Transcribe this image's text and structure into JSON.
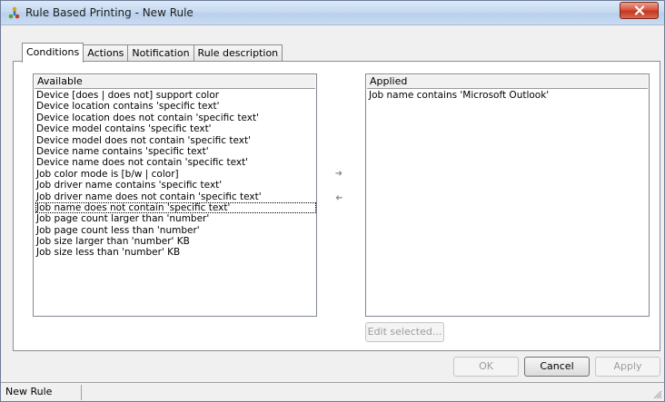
{
  "window": {
    "title": "Rule Based Printing - New Rule"
  },
  "tabs": [
    {
      "label": "Conditions"
    },
    {
      "label": "Actions"
    },
    {
      "label": "Notification"
    },
    {
      "label": "Rule description"
    }
  ],
  "available": {
    "header": "Available",
    "items": [
      "Device [does | does not] support color",
      "Device location contains 'specific text'",
      "Device location does not contain 'specific text'",
      "Device model contains 'specific text'",
      "Device model does not contain 'specific text'",
      "Device name contains 'specific text'",
      "Device name does not contain 'specific text'",
      "Job color mode is [b/w | color]",
      "Job driver name contains 'specific text'",
      "Job driver name does not contain 'specific text'",
      "Job name does not contain 'specific text'",
      "Job page count larger than 'number'",
      "Job page count less than 'number'",
      "Job size larger than 'number' KB",
      "Job size less than 'number' KB"
    ]
  },
  "applied": {
    "header": "Applied",
    "items": [
      "Job name contains 'Microsoft Outlook'"
    ]
  },
  "buttons": {
    "edit_selected": "Edit selected...",
    "ok": "OK",
    "cancel": "Cancel",
    "apply": "Apply"
  },
  "status": {
    "text": "New Rule"
  },
  "icons": {
    "app": "printer-rule-icon",
    "close": "close-icon",
    "add": "arrow-right-icon",
    "remove": "arrow-left-icon",
    "grip": "resize-grip-icon"
  },
  "colors": {
    "close_button": "#c4371f",
    "title_bar": "#c7daf1"
  }
}
